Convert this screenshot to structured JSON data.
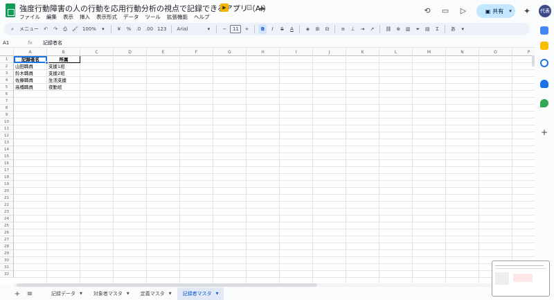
{
  "title": "強度行動障害の人の行動を応用行動分析の視点で記録できるアプリ（AI）",
  "menu": [
    "ファイル",
    "編集",
    "表示",
    "挿入",
    "表示形式",
    "データ",
    "ツール",
    "拡張機能",
    "ヘルプ"
  ],
  "share": {
    "label": "共有"
  },
  "avatar": {
    "label": "代表"
  },
  "toolbar": {
    "search": "メニュー",
    "zoom": "100%",
    "currency": "¥",
    "percent": "%",
    "dec_decrease": ".0",
    "dec_increase": ".00",
    "number_format": "123",
    "font": "Arial",
    "font_size": "11",
    "minus": "−",
    "plus": "+",
    "bold": "B",
    "italic": "I",
    "sigma": "Σ"
  },
  "formula_bar": {
    "cell_ref": "A1",
    "fx": "fx",
    "content": "記録者名"
  },
  "columns": [
    "A",
    "B",
    "C",
    "D",
    "E",
    "F",
    "G",
    "H",
    "I",
    "J",
    "K",
    "L",
    "M",
    "N",
    "O",
    "P"
  ],
  "rows": [
    "1",
    "2",
    "3",
    "4",
    "5",
    "6",
    "7",
    "8",
    "9",
    "10",
    "11",
    "12",
    "13",
    "14",
    "15",
    "16",
    "17",
    "18",
    "19",
    "20",
    "21",
    "22",
    "23",
    "24",
    "25",
    "26",
    "27",
    "28",
    "29",
    "30",
    "31",
    "32"
  ],
  "table": {
    "headers": [
      "記録者名",
      "所属"
    ],
    "rows": [
      [
        "山田職員",
        "支援1班"
      ],
      [
        "鈴木職員",
        "支援2班"
      ],
      [
        "佐藤職員",
        "生活支援"
      ],
      [
        "高橋職員",
        "夜勤班"
      ]
    ]
  },
  "sheets": [
    {
      "label": "記録データ",
      "active": false
    },
    {
      "label": "対象者マスタ",
      "active": false
    },
    {
      "label": "定義マスタ",
      "active": false
    },
    {
      "label": "記録者マスタ",
      "active": true
    }
  ],
  "colors": {
    "accent": "#1a73e8",
    "share_bg": "#c2e7ff",
    "sheets_green": "#0f9d58",
    "active_tab_bg": "#e1e9f7"
  }
}
